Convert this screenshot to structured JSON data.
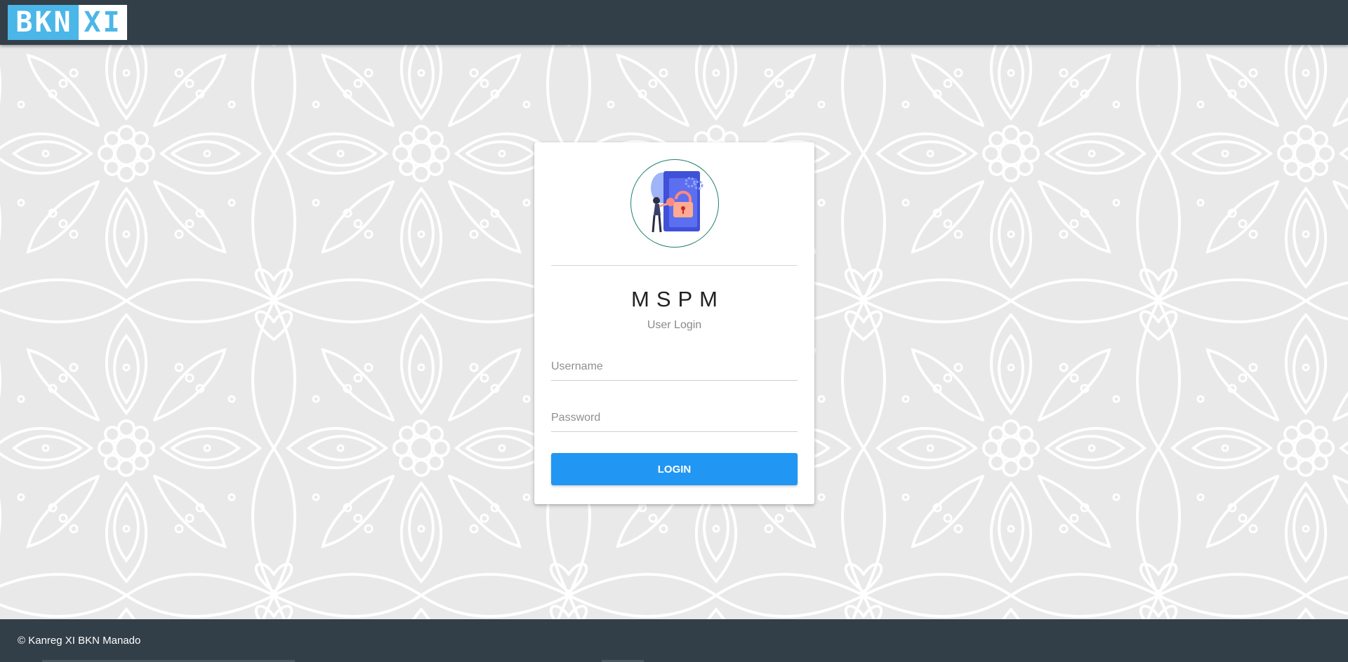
{
  "header": {
    "logo_left": "BKN",
    "logo_right": "XI",
    "logo_colors": {
      "primary": "#4bb6e8",
      "secondary": "#ffffff"
    },
    "background_color": "#323f48"
  },
  "login": {
    "title": "MSPM",
    "subtitle": "User Login",
    "avatar_icon": "user-unlock-illustration-icon",
    "username_placeholder": "Username",
    "password_placeholder": "Password",
    "login_label": "LOGIN",
    "button_color": "#2196f3"
  },
  "footer": {
    "text": "© Kanreg XI BKN Manado"
  }
}
